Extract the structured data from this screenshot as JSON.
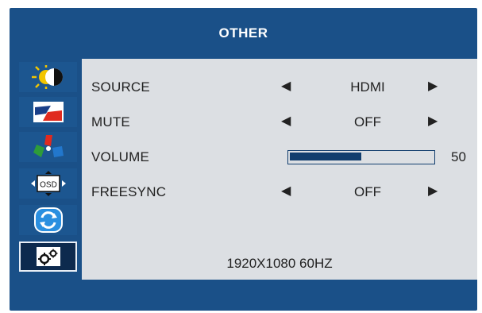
{
  "header": {
    "title": "OTHER"
  },
  "sidebar": {
    "items": [
      {
        "icon": "brightness-contrast-icon"
      },
      {
        "icon": "image-color-icon"
      },
      {
        "icon": "color-rgb-icon"
      },
      {
        "icon": "osd-settings-icon"
      },
      {
        "icon": "reset-icon"
      },
      {
        "icon": "other-settings-icon",
        "active": true
      }
    ]
  },
  "menu": {
    "source": {
      "label": "SOURCE",
      "value": "HDMI"
    },
    "mute": {
      "label": "MUTE",
      "value": "OFF"
    },
    "volume": {
      "label": "VOLUME",
      "value": "50",
      "level": 0.5
    },
    "freesync": {
      "label": "FREESYNC",
      "value": "OFF"
    }
  },
  "status": {
    "resolution": "1920X1080  60HZ"
  },
  "colors": {
    "frame": "#1a5088",
    "panel": "#dcdfe3",
    "active": "#0d2a4e",
    "bar": "#123e6e"
  }
}
